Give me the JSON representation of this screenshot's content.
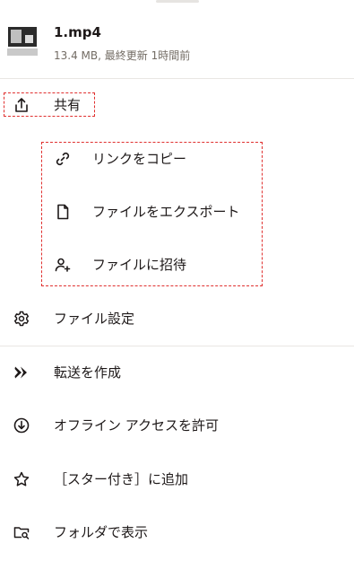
{
  "file": {
    "name": "1.mp4",
    "meta": "13.4 MB, 最終更新 1時間前"
  },
  "menu": {
    "share": {
      "label": "共有",
      "icon": "share-icon"
    },
    "share_submenu": [
      {
        "label": "リンクをコピー",
        "icon": "link-icon"
      },
      {
        "label": "ファイルをエクスポート",
        "icon": "file-icon"
      },
      {
        "label": "ファイルに招待",
        "icon": "invite-user-icon"
      }
    ],
    "file_settings": {
      "label": "ファイル設定",
      "icon": "gear-icon"
    },
    "create_transfer": {
      "label": "転送を作成",
      "icon": "transfer-icon"
    },
    "offline_access": {
      "label": "オフライン アクセスを許可",
      "icon": "offline-download-icon"
    },
    "add_star": {
      "label": "［スター付き］に追加",
      "icon": "star-icon"
    },
    "show_in_folder": {
      "label": "フォルダで表示",
      "icon": "folder-search-icon"
    }
  },
  "colors": {
    "text": "#1e1919",
    "secondary_text": "#736c64",
    "annotation_dash": "#e0302f",
    "divider": "#e9e6e3"
  }
}
